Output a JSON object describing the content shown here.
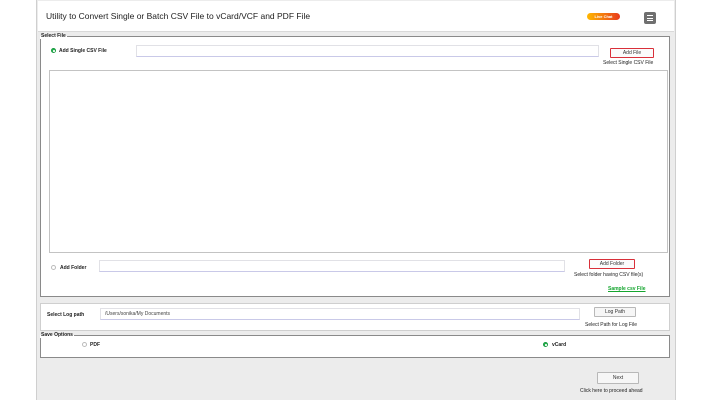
{
  "app": {
    "title": "Utility to Convert Single or Batch CSV File to vCard/VCF and PDF File",
    "badge_label": "Live Chat",
    "menu_icon": "hamburger-icon"
  },
  "select_file": {
    "legend": "Select File",
    "single": {
      "label": "Add Single CSV File",
      "selected": true,
      "value": "",
      "button": "Add File",
      "hint": "Select Single CSV File"
    },
    "folder": {
      "label": "Add Folder",
      "selected": false,
      "value": "",
      "button": "Add Folder",
      "hint": "Select folder having CSV file(s)"
    },
    "sample_link": "Sample csv File"
  },
  "log": {
    "label": "Select Log path",
    "value": "/Users/sonika/My Documents",
    "button": "Log Path",
    "hint": "Select Path for Log File"
  },
  "save_options": {
    "legend": "Save Options",
    "options": [
      {
        "label": "PDF",
        "selected": false
      },
      {
        "label": "vCard",
        "selected": true
      }
    ]
  },
  "footer": {
    "next_button": "Next",
    "hint": "Click here to proceed ahead"
  },
  "colors": {
    "accent_green": "#22b14c",
    "highlight_red": "#d9303a",
    "link_green": "#15a52f"
  }
}
